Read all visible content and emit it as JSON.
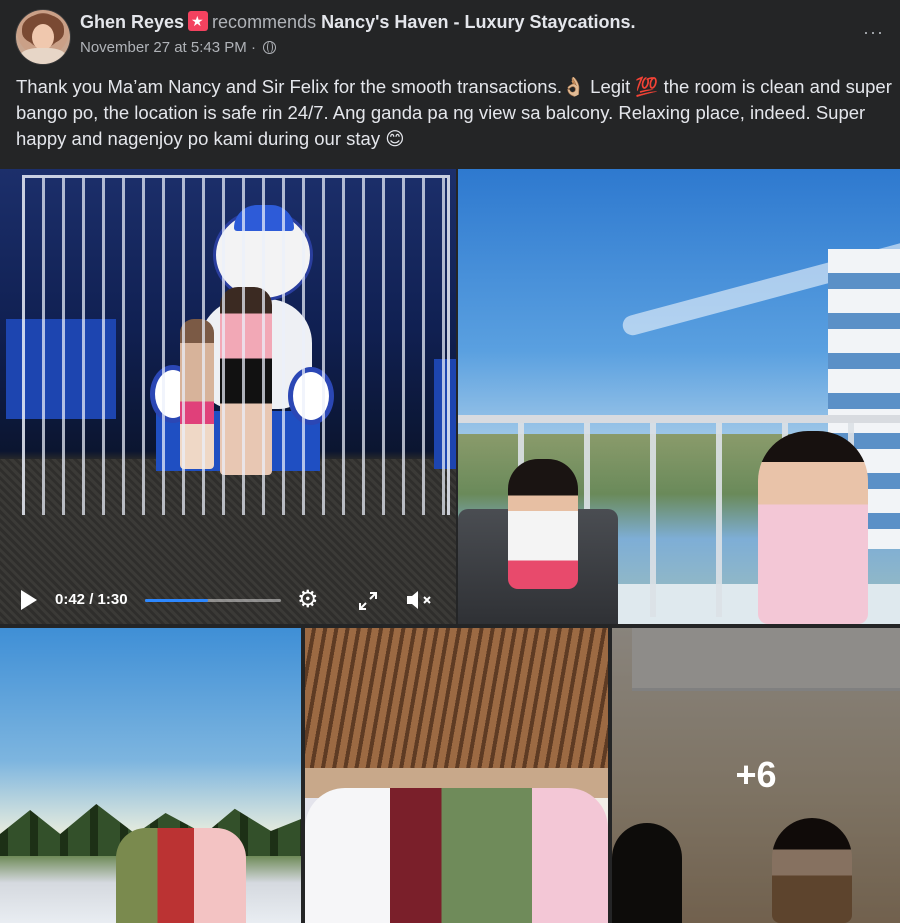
{
  "post": {
    "author": "Ghen Reyes",
    "action": "recommends",
    "page_name": "Nancy's Haven - Luxury Staycations.",
    "timestamp": "November 27 at 5:43 PM",
    "separator": "·",
    "more_icon": "···",
    "caption": "Thank you Ma’am Nancy and Sir Felix for the smooth transactions.👌🏼 Legit 💯 the room is clean and super bango po, the location is safe rin 24/7. Ang ganda pa ng view sa balcony. Relaxing place, indeed. Super happy and nagenjoy po kami during our stay 😊"
  },
  "video": {
    "time": "0:42 / 1:30",
    "progress": 0.466,
    "icons": [
      "play-icon",
      "gear-icon",
      "fullscreen-icon",
      "volume-muted-icon"
    ]
  },
  "gallery": {
    "more_count": "+6"
  },
  "colors": {
    "background": "#242526",
    "text": "#e4e6eb",
    "muted": "#b0b3b8",
    "recommend_badge": "#f3425f",
    "progress": "#2d88ff"
  }
}
